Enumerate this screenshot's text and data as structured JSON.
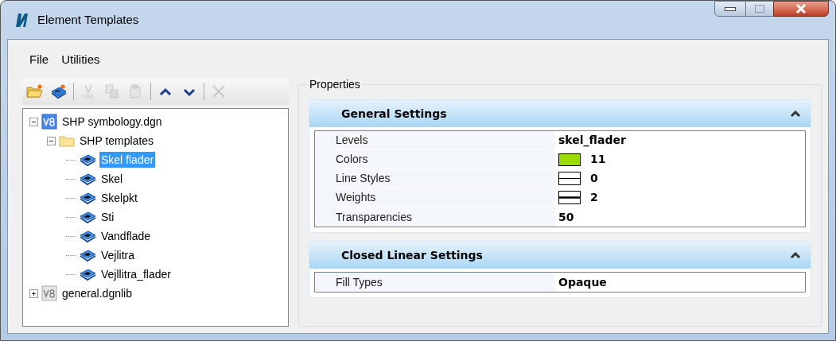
{
  "window": {
    "title": "Element Templates"
  },
  "menu": [
    "File",
    "Utilities"
  ],
  "toolbar": [
    {
      "kind": "open",
      "disabled": false
    },
    {
      "kind": "new",
      "disabled": false
    },
    {
      "kind": "separator"
    },
    {
      "kind": "cut",
      "disabled": true
    },
    {
      "kind": "copy",
      "disabled": true
    },
    {
      "kind": "paste",
      "disabled": true
    },
    {
      "kind": "separator"
    },
    {
      "kind": "up",
      "disabled": false
    },
    {
      "kind": "down",
      "disabled": false
    },
    {
      "kind": "separator"
    },
    {
      "kind": "delete",
      "disabled": true
    }
  ],
  "tree": [
    {
      "label": "SHP symbology.dgn",
      "kind": "file",
      "expanded": true,
      "selected": false,
      "children": [
        {
          "label": "SHP templates",
          "kind": "folder",
          "expanded": true,
          "selected": false,
          "children": [
            {
              "label": "Skel flader",
              "kind": "template",
              "selected": true
            },
            {
              "label": "Skel",
              "kind": "template",
              "selected": false
            },
            {
              "label": "Skelpkt",
              "kind": "template",
              "selected": false
            },
            {
              "label": "Sti",
              "kind": "template",
              "selected": false
            },
            {
              "label": "Vandflade",
              "kind": "template",
              "selected": false
            },
            {
              "label": "Vejlitra",
              "kind": "template",
              "selected": false
            },
            {
              "label": "Vejllitra_flader",
              "kind": "template",
              "selected": false
            }
          ]
        }
      ]
    },
    {
      "label": "general.dgnlib",
      "kind": "library",
      "expanded": false,
      "selected": false
    }
  ],
  "properties": {
    "title": "Properties",
    "sections": [
      {
        "title": "General Settings",
        "expanded": true,
        "rows": [
          {
            "name": "Levels",
            "value": "skel_flader",
            "kind": "text"
          },
          {
            "name": "Colors",
            "value": "11",
            "kind": "color",
            "color": "#99dd00"
          },
          {
            "name": "Line Styles",
            "value": "0",
            "kind": "linestyle"
          },
          {
            "name": "Weights",
            "value": "2",
            "kind": "weight"
          },
          {
            "name": "Transparencies",
            "value": "50",
            "kind": "text"
          }
        ]
      },
      {
        "title": "Closed Linear Settings",
        "expanded": true,
        "rows": [
          {
            "name": "Fill Types",
            "value": "Opaque",
            "kind": "text"
          }
        ]
      }
    ]
  }
}
